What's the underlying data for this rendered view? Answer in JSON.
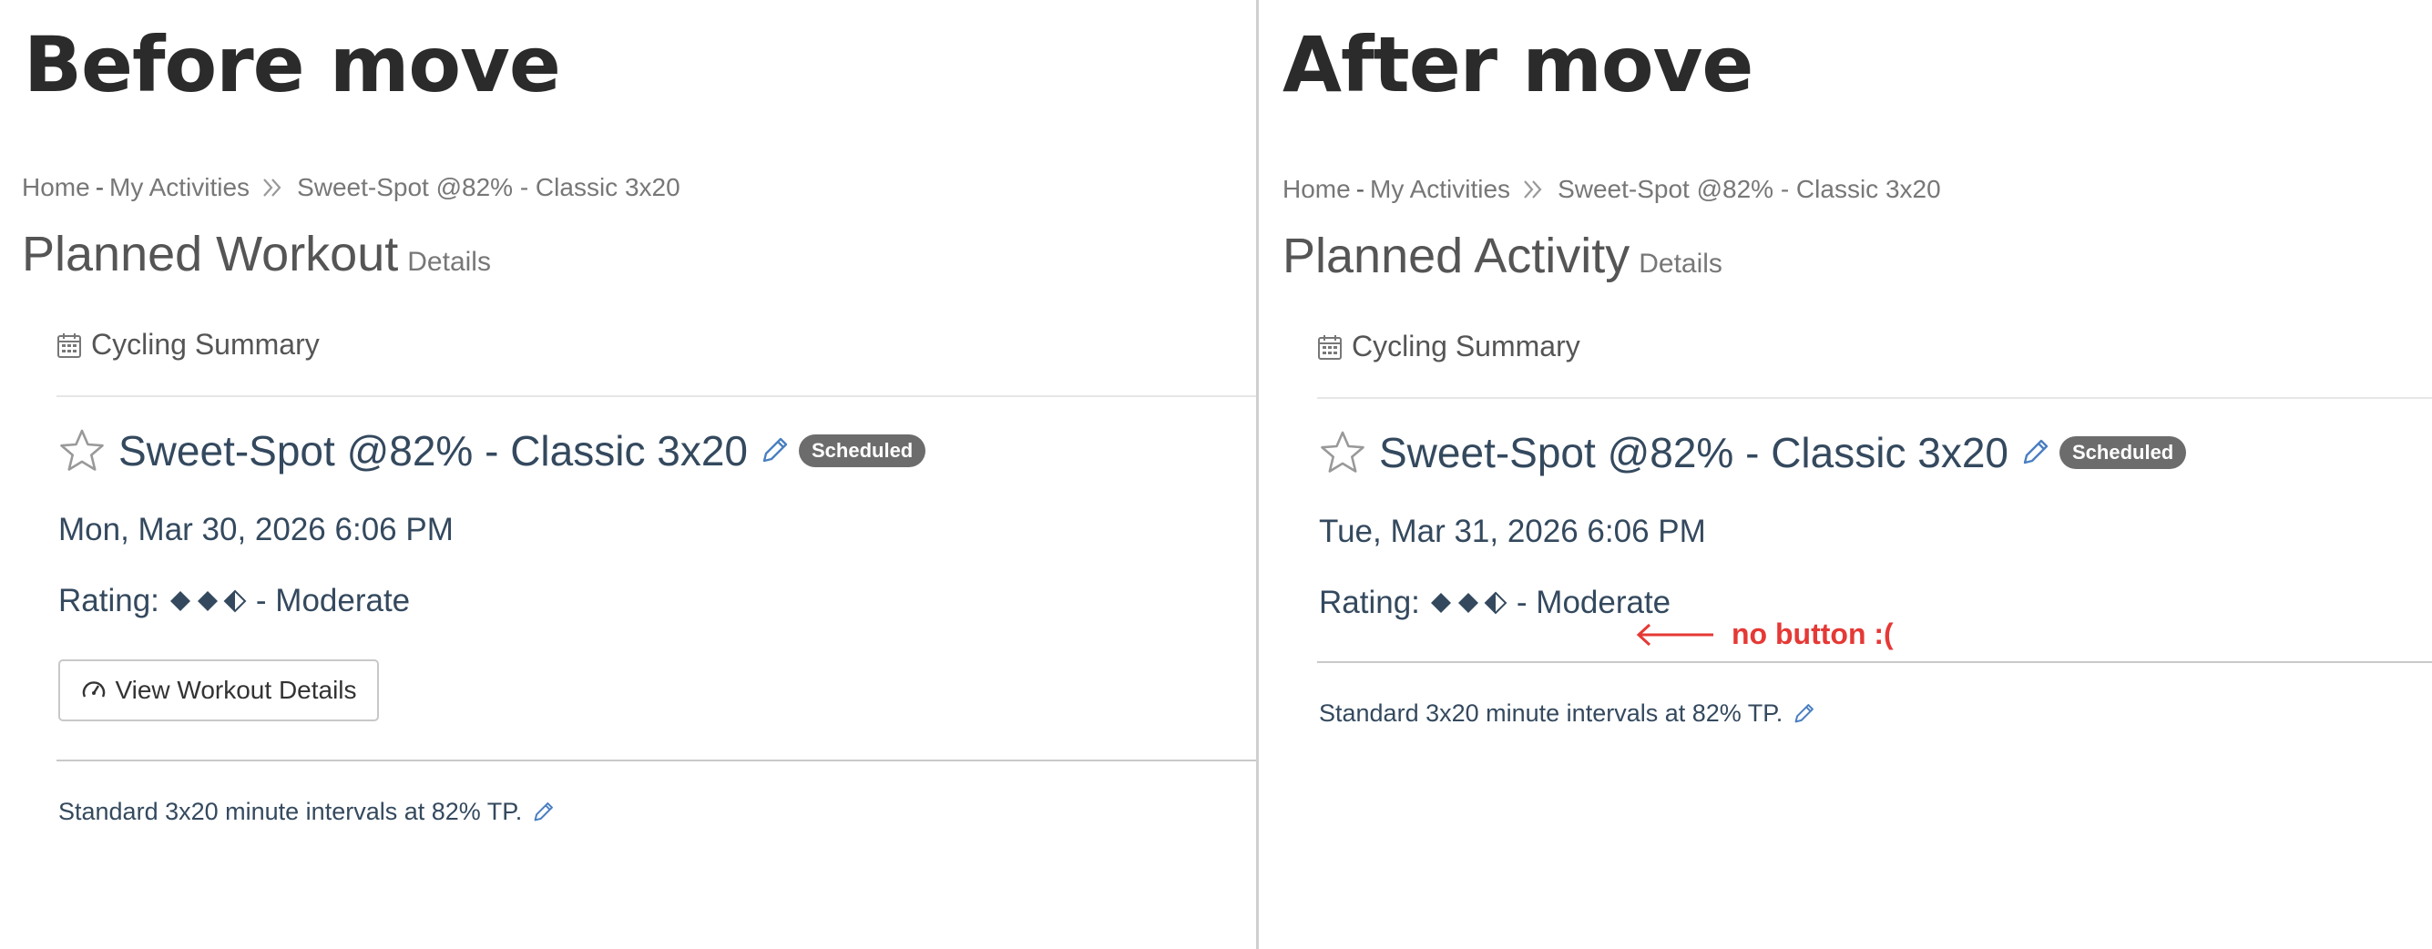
{
  "left_panel": {
    "heading": "Before move",
    "breadcrumb": {
      "home": "Home",
      "dash": "-",
      "activities": "My Activities",
      "current": "Sweet-Spot @82% - Classic 3x20"
    },
    "page_title": "Planned Workout",
    "page_subtitle": "Details",
    "section_label": "Cycling Summary",
    "workout_name": "Sweet-Spot @82% - Classic 3x20",
    "status_badge": "Scheduled",
    "date": "Mon, Mar 30, 2026 6:06 PM",
    "rating_prefix": "Rating:",
    "rating_suffix": "- Moderate",
    "rating_level": {
      "filled": 2,
      "half": 1,
      "total": 3
    },
    "details_button": "View Workout Details",
    "description": "Standard 3x20 minute intervals at 82% TP."
  },
  "right_panel": {
    "heading": "After move",
    "breadcrumb": {
      "home": "Home",
      "dash": "-",
      "activities": "My Activities",
      "current": "Sweet-Spot @82% - Classic 3x20"
    },
    "page_title": "Planned Activity",
    "page_subtitle": "Details",
    "section_label": "Cycling Summary",
    "workout_name": "Sweet-Spot @82% - Classic 3x20",
    "status_badge": "Scheduled",
    "date": "Tue, Mar 31, 2026 6:06 PM",
    "rating_prefix": "Rating:",
    "rating_suffix": "- Moderate",
    "rating_level": {
      "filled": 2,
      "half": 1,
      "total": 3
    },
    "annotation": "no button :(",
    "description": "Standard 3x20 minute intervals at 82% TP."
  },
  "icons": {
    "star": "star-outline-icon",
    "pencil": "pencil-icon",
    "calendar": "calendar-icon",
    "gauge": "gauge-icon",
    "chevrons": "double-chevron-right-icon",
    "arrow": "left-arrow-icon"
  },
  "colors": {
    "accent_blue": "#4a7fc1",
    "title_text": "#34495e",
    "badge_bg": "#6c6c6c",
    "annotation_red": "#e53935"
  }
}
